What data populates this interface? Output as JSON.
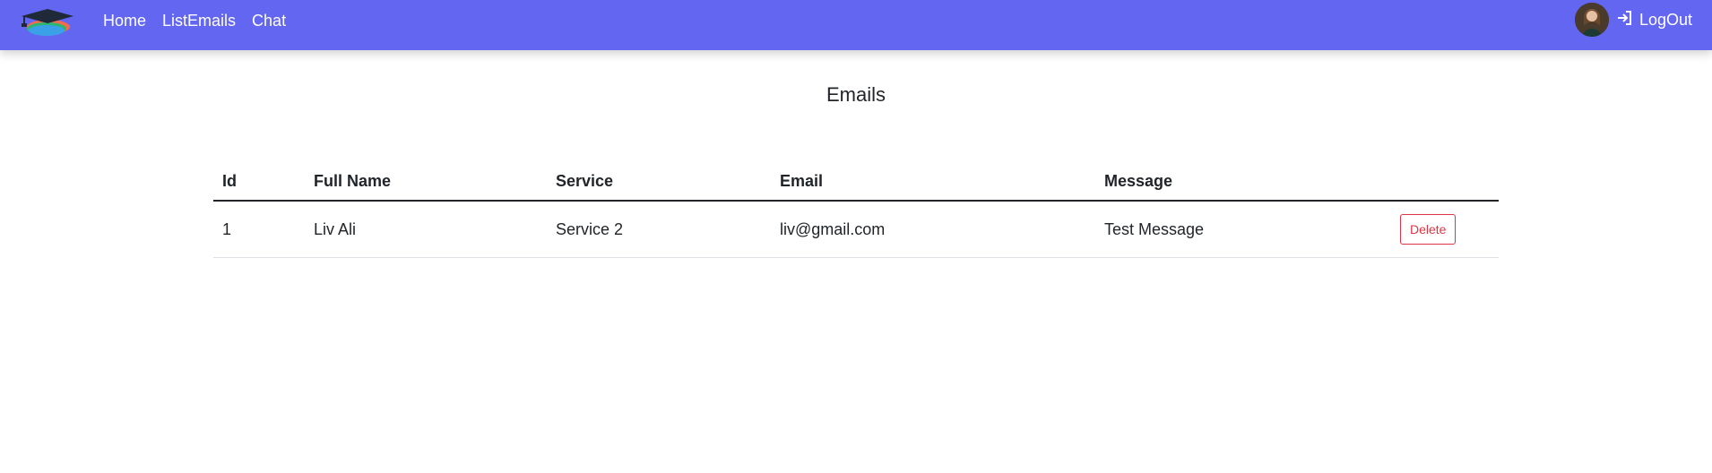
{
  "nav": {
    "links": [
      "Home",
      "ListEmails",
      "Chat"
    ],
    "logout_label": "LogOut",
    "logo_icon": "graduation-cap-icon",
    "logout_icon": "login-arrow-icon",
    "accent_color": "#6366f1"
  },
  "page": {
    "title": "Emails"
  },
  "table": {
    "headers": [
      "Id",
      "Full Name",
      "Service",
      "Email",
      "Message",
      ""
    ],
    "rows": [
      {
        "id": "1",
        "full_name": "Liv Ali",
        "service": "Service 2",
        "email": "liv@gmail.com",
        "message": "Test Message",
        "action_label": "Delete"
      }
    ]
  }
}
